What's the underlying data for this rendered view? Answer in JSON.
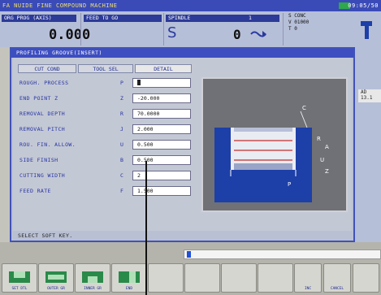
{
  "title_bar": {
    "title": "FA NUIDE FINE COMPOUND MACHINE",
    "clock": "09:05/50"
  },
  "header": {
    "position_label": "ORG PROG (AXIS)",
    "position_value": "0.000",
    "feed_label": "FEED TO GO",
    "spindle_label": "SPINDLE",
    "spindle_letter": "S",
    "spindle_num_label": "1",
    "spindle_value": "0",
    "mode_lines": [
      "S  CONC",
      "V  01000",
      "T  0"
    ]
  },
  "dialog": {
    "title": "PROFILING GROOVE(INSERT)",
    "tabs": [
      "CUT COND",
      "TOOL SEL",
      "DETAIL"
    ],
    "params": [
      {
        "label": "ROUGH. PROCESS",
        "key": "P",
        "value": "",
        "cursor": true
      },
      {
        "label": "END POINT Z",
        "key": "Z",
        "value": "-20.000"
      },
      {
        "label": "REMOVAL DEPTH",
        "key": "R",
        "value": "70.0000"
      },
      {
        "label": "REMOVAL PITCH",
        "key": "J",
        "value": "2.000"
      },
      {
        "label": "ROU. FIN. ALLOW.",
        "key": "U",
        "value": "0.500"
      },
      {
        "label": "SIDE FINISH",
        "key": "B",
        "value": "0.500"
      },
      {
        "label": "CUTTING WIDTH",
        "key": "C",
        "value": "2"
      },
      {
        "label": "FEED RATE",
        "key": "F",
        "value": "1.500"
      }
    ],
    "diagram_labels": {
      "c": "C",
      "r": "R",
      "a": "A",
      "u": "U",
      "z": "Z",
      "p": "P"
    },
    "prompt": "SELECT SOFT KEY."
  },
  "side_panel": {
    "tab_lines": [
      "AD",
      "13.1"
    ]
  },
  "softkeys": [
    {
      "label": "SET DTL",
      "icon": "groove-outer-icon"
    },
    {
      "label": "OUTER GR",
      "icon": "groove-face-icon"
    },
    {
      "label": "INNER GR",
      "icon": "groove-inner-icon"
    },
    {
      "label": "END",
      "icon": "groove-end-icon"
    },
    {
      "label": "",
      "icon": ""
    },
    {
      "label": "",
      "icon": ""
    },
    {
      "label": "",
      "icon": ""
    },
    {
      "label": "",
      "icon": ""
    },
    {
      "label": "",
      "icon": ""
    },
    {
      "label": "INC",
      "icon": ""
    },
    {
      "label": "CANCEL",
      "icon": ""
    }
  ],
  "colors": {
    "accent": "#3d4ec0",
    "workpiece": "#1d3fa8",
    "panel": "#c3c8d5"
  }
}
